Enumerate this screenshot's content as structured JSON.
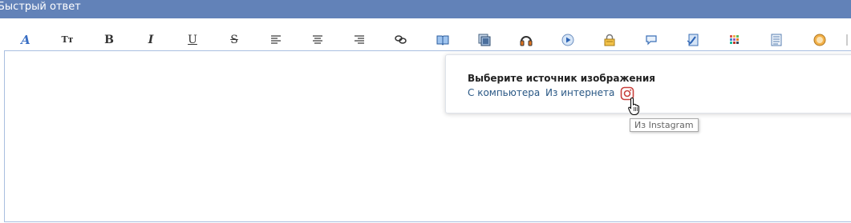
{
  "header": {
    "title": "Быстрый ответ"
  },
  "toolbar": {
    "font_style": "Tт",
    "bold": "B",
    "italic": "I",
    "underline": "U",
    "strike": "S"
  },
  "image_popup": {
    "title": "Выберите источник изображения",
    "from_computer": "С компьютера",
    "from_internet": "Из интернета",
    "instagram_tooltip": "Из Instagram"
  },
  "colors": {
    "header_bg": "#6282b8",
    "link": "#2a5885",
    "instagram": "#c8403c",
    "editor_border": "#a9bfe0"
  }
}
